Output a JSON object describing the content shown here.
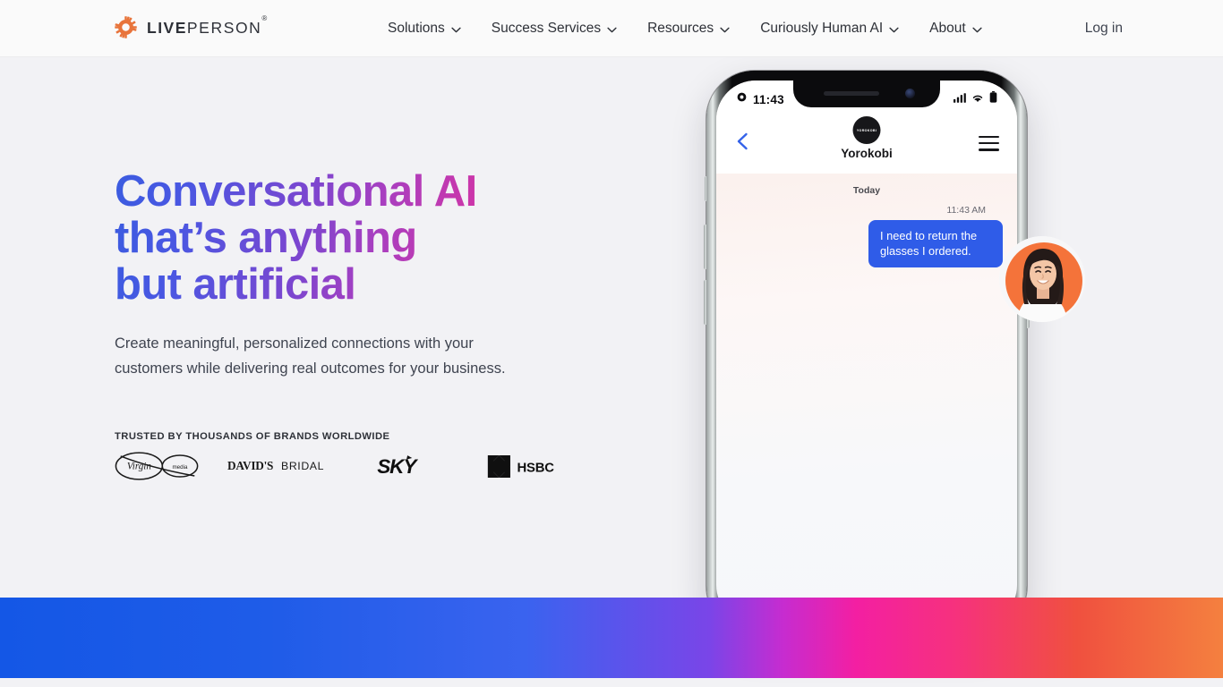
{
  "nav": {
    "logo": {
      "icon": "gear-icon",
      "text_bold": "LIVE",
      "text_light": "PERSON",
      "trademark": "®"
    },
    "items": [
      {
        "label": "Solutions",
        "icon": "chevron-down-icon"
      },
      {
        "label": "Success Services",
        "icon": "chevron-down-icon"
      },
      {
        "label": "Resources",
        "icon": "chevron-down-icon"
      },
      {
        "label": "Curiously Human AI",
        "icon": "chevron-down-icon"
      },
      {
        "label": "About",
        "icon": "chevron-down-icon"
      }
    ],
    "login_label": "Log in"
  },
  "hero": {
    "headline_line1": "Conversational AI",
    "headline_line2": "that’s anything",
    "headline_line3": "but artificial",
    "headline_gradient_start": "#3b5ce0",
    "headline_gradient_end": "#e0349a",
    "subhead": "Create meaningful, personalized connections with your customers while delivering real outcomes for your business.",
    "trusted_label": "TRUSTED BY THOUSANDS OF BRANDS WORLDWIDE",
    "brands": [
      {
        "name": "Virgin Media",
        "icon": "virgin-media-logo"
      },
      {
        "name": "David's Bridal",
        "icon": "davids-bridal-logo"
      },
      {
        "name": "SKY",
        "icon": "sky-logo"
      },
      {
        "name": "HSBC",
        "icon": "hsbc-logo"
      }
    ]
  },
  "phone": {
    "status": {
      "time": "11:43",
      "left_icon": "gear-icon",
      "right_icons": [
        "signal-bars-icon",
        "wifi-icon",
        "battery-icon"
      ]
    },
    "chat_header": {
      "back_icon": "back-chevron-icon",
      "avatar_text": "YOROKOBI",
      "title": "Yorokobi",
      "menu_icon": "hamburger-menu-icon"
    },
    "chat": {
      "day_divider": "Today",
      "messages": [
        {
          "time": "11:43 AM",
          "text": "I need to return the glasses I ordered.",
          "side": "outgoing",
          "bubble_color": "#2f5ce8"
        }
      ]
    },
    "agent_avatar": {
      "icon": "agent-photo-avatar",
      "background_color": "#f4733a"
    }
  },
  "footer_bar": {
    "gradient_stops": [
      "#1457e6",
      "#7a45e8",
      "#f31fa2",
      "#f0503f",
      "#f4803f"
    ]
  }
}
